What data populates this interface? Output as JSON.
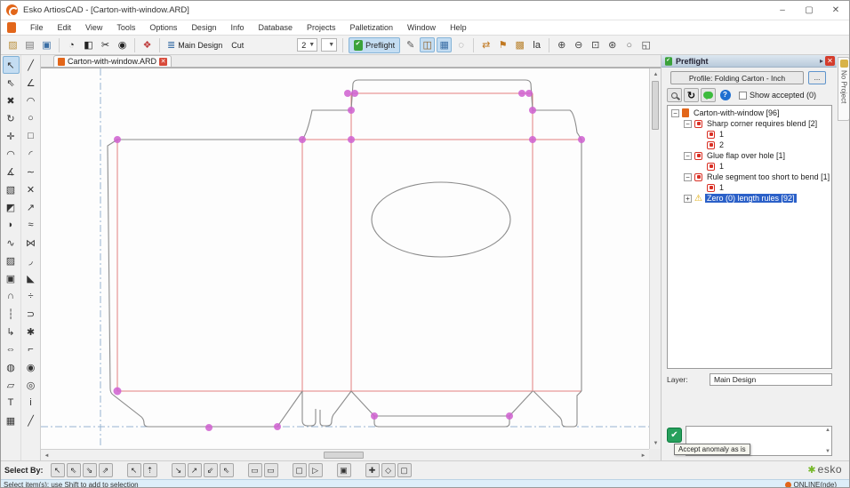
{
  "titlebar": {
    "title": "Esko ArtiosCAD - [Carton-with-window.ARD]",
    "minimize": "–",
    "maximize": "▢",
    "close": "✕"
  },
  "menu_items": [
    "File",
    "Edit",
    "View",
    "Tools",
    "Options",
    "Design",
    "Info",
    "Database",
    "Projects",
    "Palletization",
    "Window",
    "Help"
  ],
  "toolbar": {
    "layer_selector": "Main Design",
    "mode_label": "Cut",
    "count_value": "2",
    "preflight_label": "Preflight",
    "icons_file": [
      {
        "name": "open-file-icon",
        "glyph": "▨",
        "color": "#b98e3a"
      },
      {
        "name": "plot-output-icon",
        "glyph": "▤",
        "color": "#777777"
      },
      {
        "name": "save-icon",
        "glyph": "▣",
        "color": "#3a6ea5"
      }
    ],
    "icons_design": [
      {
        "name": "rebuild-design-icon",
        "glyph": "◔",
        "color": "#222222"
      },
      {
        "name": "convert-to-3d-icon",
        "glyph": "◧",
        "color": "#222222"
      },
      {
        "name": "cut-parts-icon",
        "glyph": "✂",
        "color": "#222222"
      },
      {
        "name": "canvas-parts-icon",
        "glyph": "◉",
        "color": "#222222"
      }
    ],
    "icons_palette": [
      {
        "name": "color-palette-icon",
        "glyph": "❖",
        "color": "#c04040"
      }
    ],
    "icons_modes": [
      {
        "name": "sketch-mode-icon",
        "glyph": "✎",
        "color": "#555555"
      },
      {
        "name": "artios-3d-icon",
        "glyph": "◫",
        "color": "#8a5a22",
        "pressed": true
      },
      {
        "name": "window-grid-icon",
        "glyph": "▦",
        "color": "#3a6ea5",
        "pressed": true
      },
      {
        "name": "lasso-icon",
        "glyph": "◌",
        "color": "#777777"
      }
    ],
    "icons_output": [
      {
        "name": "compare-arrows-icon",
        "glyph": "⇄",
        "color": "#c07820"
      },
      {
        "name": "flag-icon",
        "glyph": "⚑",
        "color": "#c07820"
      },
      {
        "name": "package-icon",
        "glyph": "▩",
        "color": "#b9832f"
      },
      {
        "name": "la-tool-icon",
        "glyph": "la",
        "color": "#333333"
      }
    ],
    "icons_zoom": [
      {
        "name": "zoom-in-icon",
        "glyph": "⊕",
        "color": "#444444"
      },
      {
        "name": "zoom-out-icon",
        "glyph": "⊖",
        "color": "#444444"
      },
      {
        "name": "zoom-window-icon",
        "glyph": "⊡",
        "color": "#444444"
      },
      {
        "name": "zoom-point-icon",
        "glyph": "⊛",
        "color": "#444444"
      },
      {
        "name": "circle-overlay-icon",
        "glyph": "○",
        "color": "#666666"
      },
      {
        "name": "fit-screen-icon",
        "glyph": "◱",
        "color": "#444444"
      }
    ]
  },
  "tab": {
    "label": "Carton-with-window.ARD"
  },
  "palette": {
    "col1": [
      {
        "name": "select-tool",
        "glyph": "↖",
        "active": true
      },
      {
        "name": "group-select-tool",
        "glyph": "⇖"
      },
      {
        "name": "delete-tool",
        "glyph": "✖"
      },
      {
        "name": "rotate-tool",
        "glyph": "↻"
      },
      {
        "name": "move-tool",
        "glyph": "✛"
      },
      {
        "name": "adjust-arc-tool",
        "glyph": "◠"
      },
      {
        "name": "measure-tool",
        "glyph": "∡"
      },
      {
        "name": "stamp-tool",
        "glyph": "▧"
      },
      {
        "name": "fill-tool",
        "glyph": "◩"
      },
      {
        "name": "blend-tool",
        "glyph": "◗"
      },
      {
        "name": "curve-edit-tool",
        "glyph": "∿"
      },
      {
        "name": "hatch-tool",
        "glyph": "▨"
      },
      {
        "name": "image-tool",
        "glyph": "▣"
      },
      {
        "name": "bridge-tool",
        "glyph": "∩"
      },
      {
        "name": "perf-tool",
        "glyph": "┆"
      },
      {
        "name": "arrow-path-tool",
        "glyph": "↳"
      },
      {
        "name": "dimension-tool",
        "glyph": "⇔"
      },
      {
        "name": "globe-tool",
        "glyph": "◍"
      },
      {
        "name": "clone-tool",
        "glyph": "▱"
      },
      {
        "name": "text-tool",
        "glyph": "T"
      },
      {
        "name": "table-tool",
        "glyph": "▦"
      }
    ],
    "col2": [
      {
        "name": "line-tool",
        "glyph": "╱"
      },
      {
        "name": "line-angle-tool",
        "glyph": "∠"
      },
      {
        "name": "arc-point-tool",
        "glyph": "◠"
      },
      {
        "name": "circle-tool",
        "glyph": "○"
      },
      {
        "name": "rectangle-tool",
        "glyph": "□"
      },
      {
        "name": "arc-tool",
        "glyph": "◜"
      },
      {
        "name": "bezier-tool",
        "glyph": "∼"
      },
      {
        "name": "trim-tool",
        "glyph": "✕"
      },
      {
        "name": "extend-tool",
        "glyph": "↗"
      },
      {
        "name": "offset-tool",
        "glyph": "≈"
      },
      {
        "name": "mirror-tool",
        "glyph": "⋈"
      },
      {
        "name": "fillet-tool",
        "glyph": "◞"
      },
      {
        "name": "chamfer-tool",
        "glyph": "◣"
      },
      {
        "name": "divide-tool",
        "glyph": "÷"
      },
      {
        "name": "join-tool",
        "glyph": "⊃"
      },
      {
        "name": "node-edit-tool",
        "glyph": "✱"
      },
      {
        "name": "corner-tool",
        "glyph": "⌐"
      },
      {
        "name": "lock-tool",
        "glyph": "◉"
      },
      {
        "name": "counter-tool",
        "glyph": "◎"
      },
      {
        "name": "info-tool",
        "glyph": "i"
      },
      {
        "name": "slant-line-tool",
        "glyph": "╱"
      }
    ]
  },
  "preflight": {
    "title": "Preflight",
    "profile": "Profile: Folding Carton - Inch",
    "more": "...",
    "show_accepted": "Show accepted (0)",
    "tree": [
      {
        "label": "Carton-with-window [96]",
        "level": 0,
        "icon": "doc",
        "expander": "-"
      },
      {
        "label": "Sharp corner requires blend [2]",
        "level": 1,
        "icon": "error",
        "expander": "-"
      },
      {
        "label": "1",
        "level": 2,
        "icon": "error"
      },
      {
        "label": "2",
        "level": 2,
        "icon": "error"
      },
      {
        "label": "Glue flap over hole [1]",
        "level": 1,
        "icon": "error",
        "expander": "-"
      },
      {
        "label": "1",
        "level": 2,
        "icon": "error"
      },
      {
        "label": "Rule segment too short to bend [1]",
        "level": 1,
        "icon": "error",
        "expander": "-"
      },
      {
        "label": "1",
        "level": 2,
        "icon": "error"
      },
      {
        "label": "Zero (0) length rules [92]",
        "level": 1,
        "icon": "warning",
        "expander": "+",
        "selected": true
      }
    ],
    "layer_label": "Layer:",
    "layer_value": "Main Design",
    "tooltip": "Accept anomaly as is"
  },
  "right_strip": {
    "tab_label": "No Project"
  },
  "bottom_toolbar": {
    "label": "Select By:",
    "groups": [
      [
        {
          "name": "select-all-button",
          "glyph": "↖"
        },
        {
          "name": "select-designs-button",
          "glyph": "⇖"
        },
        {
          "name": "select-inside-button",
          "glyph": "⇘"
        },
        {
          "name": "select-touching-button",
          "glyph": "⇗"
        }
      ],
      [
        {
          "name": "select-point-button",
          "glyph": "↖"
        },
        {
          "name": "select-snap-button",
          "glyph": "⇡"
        }
      ],
      [
        {
          "name": "select-line-button",
          "glyph": "↘"
        },
        {
          "name": "select-arc-button",
          "glyph": "↗"
        },
        {
          "name": "select-curve-button",
          "glyph": "⇙"
        },
        {
          "name": "select-text-button",
          "glyph": "⇖"
        }
      ],
      [
        {
          "name": "select-rect-inside-button",
          "glyph": "▭"
        },
        {
          "name": "select-rect-touching-button",
          "glyph": "▭"
        }
      ],
      [
        {
          "name": "select-group-button",
          "glyph": "▢"
        },
        {
          "name": "select-layer-button",
          "glyph": "▷"
        }
      ],
      [
        {
          "name": "select-copy-button",
          "glyph": "▣"
        }
      ],
      [
        {
          "name": "select-color-button",
          "glyph": "✚"
        },
        {
          "name": "select-type-button",
          "glyph": "◇"
        },
        {
          "name": "select-zoom-button",
          "glyph": "▢"
        }
      ]
    ]
  },
  "status": {
    "message": "Select item(s); use Shift to add to selection",
    "online": "ONLINE(nde)"
  },
  "branding": {
    "logo_star": "✱",
    "logo_text": "esko"
  },
  "colors": {
    "accent": "#c4ddf2",
    "selection": "#2b60c8",
    "error": "#d93025",
    "warning": "#e0a800",
    "magenta_point": "#cf5fd0",
    "rule_red": "#e28080",
    "cut_gray": "#8c8c8c",
    "guide_blue": "#97b3d1",
    "esko_green": "#76b82a",
    "online_orange": "#e2661a"
  }
}
